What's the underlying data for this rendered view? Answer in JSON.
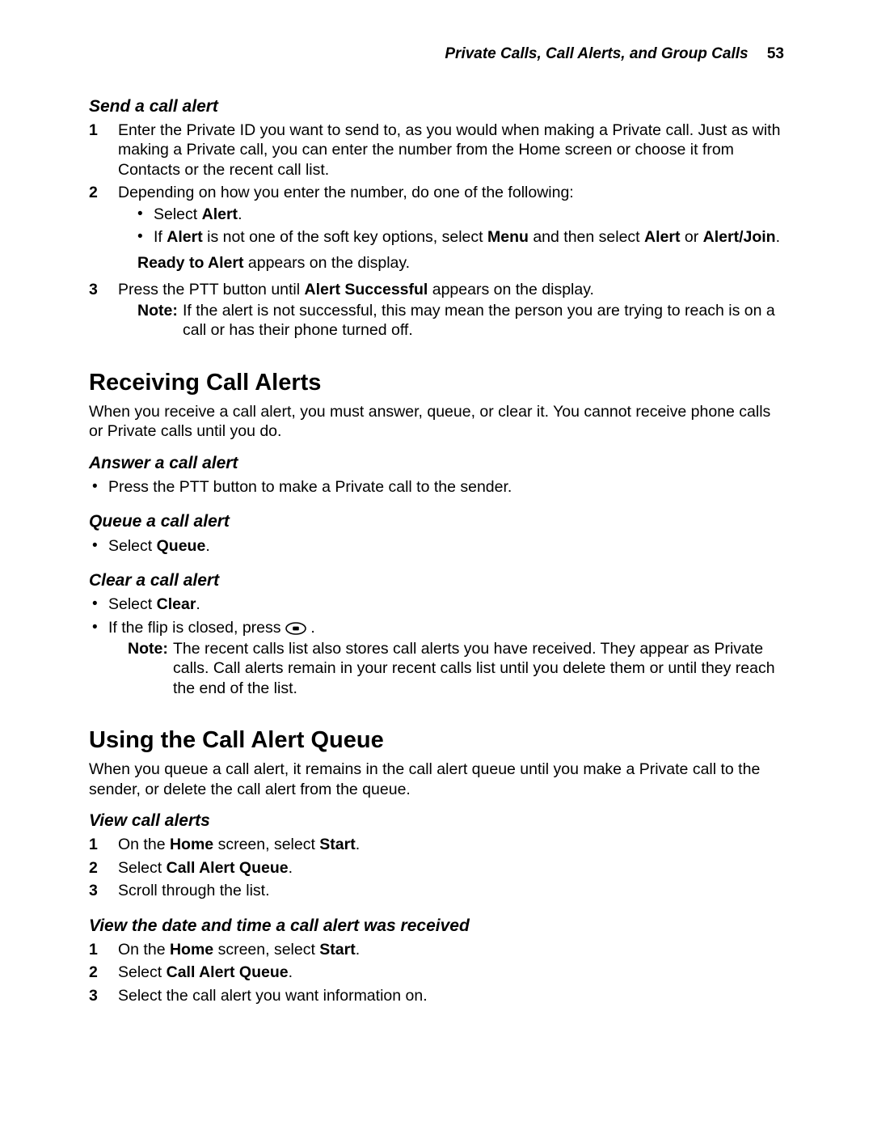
{
  "header": {
    "title": "Private Calls, Call Alerts, and Group Calls",
    "page_number": "53"
  },
  "send_alert": {
    "heading": "Send a call alert",
    "step1": "Enter the Private ID you want to send to, as you would when making a Private call. Just as with making a Private call, you can enter the number from the Home screen or choose it from Contacts or the recent call list.",
    "step2_intro": "Depending on how you enter the number, do one of the following:",
    "step2_b1_pre": "Select ",
    "step2_b1_bold": "Alert",
    "step2_b1_post": ".",
    "step2_b2_t1": "If ",
    "step2_b2_b1": "Alert",
    "step2_b2_t2": " is not one of the soft key options, select ",
    "step2_b2_b2": "Menu",
    "step2_b2_t3": " and then select ",
    "step2_b2_b3": "Alert",
    "step2_b2_t4": " or ",
    "step2_b2_b4": "Alert/Join",
    "step2_b2_t5": ".",
    "step2_follow_b": "Ready to Alert",
    "step2_follow_t": " appears on the display.",
    "step3_t1": "Press the PTT button until ",
    "step3_b1": "Alert Successful",
    "step3_t2": " appears on the display.",
    "note_label": "Note:",
    "note_text": "If the alert is not successful, this may mean the person you are trying to reach is on a call or has their phone turned off."
  },
  "receiving": {
    "heading": "Receiving Call Alerts",
    "intro": "When you receive a call alert, you must answer, queue, or clear it. You cannot receive phone calls or Private calls until you do.",
    "answer_heading": "Answer a call alert",
    "answer_b1": "Press the PTT button to make a Private call to the sender.",
    "queue_heading": "Queue a call alert",
    "queue_b1_pre": "Select ",
    "queue_b1_bold": "Queue",
    "queue_b1_post": ".",
    "clear_heading": "Clear a call alert",
    "clear_b1_pre": "Select ",
    "clear_b1_bold": "Clear",
    "clear_b1_post": ".",
    "clear_b2_pre": "If the flip is closed, press ",
    "clear_b2_post": ".",
    "note_label": "Note:",
    "note_text": "The recent calls list also stores call alerts you have received. They appear as Private calls. Call alerts remain in your recent calls list until you delete them or until they reach the end of the list."
  },
  "using_queue": {
    "heading": "Using the Call Alert Queue",
    "intro": "When you queue a call alert, it remains in the call alert queue until you make a Private call to the sender, or delete the call alert from the queue.",
    "view_heading": "View call alerts",
    "view_s1_t1": "On the ",
    "view_s1_b1": "Home",
    "view_s1_t2": " screen, select ",
    "view_s1_b2": "Start",
    "view_s1_t3": ".",
    "view_s2_t1": "Select ",
    "view_s2_b1": "Call Alert Queue",
    "view_s2_t2": ".",
    "view_s3": "Scroll through the list.",
    "viewdt_heading": "View the date and time a call alert was received",
    "viewdt_s1_t1": "On the ",
    "viewdt_s1_b1": "Home",
    "viewdt_s1_t2": " screen, select ",
    "viewdt_s1_b2": "Start",
    "viewdt_s1_t3": ".",
    "viewdt_s2_t1": "Select ",
    "viewdt_s2_b1": "Call Alert Queue",
    "viewdt_s2_t2": ".",
    "viewdt_s3": "Select the call alert you want information on."
  }
}
